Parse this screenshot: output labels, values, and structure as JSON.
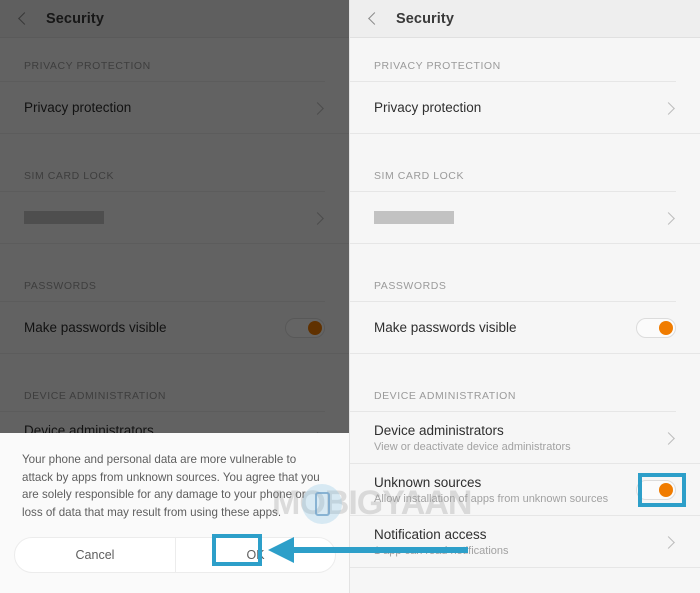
{
  "accent": {
    "highlight_blue": "#2d9fc9",
    "toggle_orange": "#f07c00"
  },
  "left_panel": {
    "appbar": {
      "title": "Security",
      "back_icon": "chevron-left-icon"
    },
    "sections": [
      {
        "header": "PRIVACY PROTECTION",
        "rows": [
          {
            "title": "Privacy protection",
            "sub": "",
            "control": "chevron"
          }
        ]
      },
      {
        "header": "SIM CARD LOCK",
        "rows": [
          {
            "title": "",
            "sub": "",
            "control": "chevron",
            "redacted": true
          }
        ]
      },
      {
        "header": "PASSWORDS",
        "rows": [
          {
            "title": "Make passwords visible",
            "sub": "",
            "control": "toggle",
            "toggle_on": true
          }
        ]
      },
      {
        "header": "DEVICE ADMINISTRATION",
        "rows": [
          {
            "title": "Device administrators",
            "sub": "View or deactivate device administrators",
            "control": "chevron"
          }
        ]
      }
    ],
    "dialog": {
      "message": "Your phone and personal data are more vulnerable to attack by apps from unknown sources. You agree that you are solely responsible for any damage to your phone or loss of data that may result from using these apps.",
      "cancel_label": "Cancel",
      "ok_label": "OK"
    }
  },
  "right_panel": {
    "appbar": {
      "title": "Security",
      "back_icon": "chevron-left-icon"
    },
    "sections": [
      {
        "header": "PRIVACY PROTECTION",
        "rows": [
          {
            "title": "Privacy protection",
            "sub": "",
            "control": "chevron"
          }
        ]
      },
      {
        "header": "SIM CARD LOCK",
        "rows": [
          {
            "title": "",
            "sub": "",
            "control": "chevron",
            "redacted": true
          }
        ]
      },
      {
        "header": "PASSWORDS",
        "rows": [
          {
            "title": "Make passwords visible",
            "sub": "",
            "control": "toggle",
            "toggle_on": true
          }
        ]
      },
      {
        "header": "DEVICE ADMINISTRATION",
        "rows": [
          {
            "title": "Device administrators",
            "sub": "View or deactivate device administrators",
            "control": "chevron"
          },
          {
            "title": "Unknown sources",
            "sub": "Allow installation of apps from unknown sources",
            "control": "toggle",
            "toggle_on": true,
            "highlighted": true
          },
          {
            "title": "Notification access",
            "sub": "1 app can read notifications",
            "control": "chevron"
          }
        ]
      }
    ]
  },
  "watermark": {
    "text": "MOBIGYAAN",
    "logo_icon": "mobile-phone-icon"
  }
}
